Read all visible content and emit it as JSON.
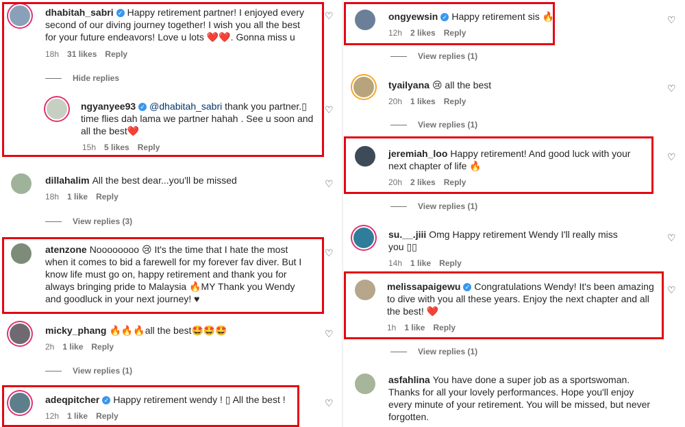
{
  "left": {
    "c1": {
      "user": "dhabitah_sabri",
      "text": "Happy retirement partner! I enjoyed every second of our diving journey together! I wish you all the best for your future endeavors! Love u lots ❤️❤️. Gonna miss u",
      "time": "18h",
      "likes": "31 likes",
      "reply": "Reply"
    },
    "hide": "Hide replies",
    "c1r": {
      "user": "ngyanyee93",
      "mention": "@dhabitah_sabri",
      "text": "thank you partner.▯ time flies dah lama we partner hahah . See u soon and all the best❤️",
      "time": "15h",
      "likes": "5 likes",
      "reply": "Reply"
    },
    "c2": {
      "user": "dillahalim",
      "text": "All the best dear...you'll be missed",
      "time": "18h",
      "likes": "1 like",
      "reply": "Reply",
      "view": "View replies (3)"
    },
    "c3": {
      "user": "atenzone",
      "text": "Noooooooo 😢 It's the time that I hate the most when it comes to bid a farewell for my forever fav diver. But I know life must go on, happy retirement and thank you for always bringing pride to Malaysia 🔥MY Thank you Wendy and goodluck in your next journey! ♥"
    },
    "c4": {
      "user": "micky_phang",
      "text": "🔥🔥🔥all the best🤩🤩🤩",
      "time": "2h",
      "likes": "1 like",
      "reply": "Reply",
      "view": "View replies (1)"
    },
    "c5": {
      "user": "adeqpitcher",
      "text": "Happy retirement wendy ! ▯ All the best !",
      "time": "12h",
      "likes": "1 like",
      "reply": "Reply"
    }
  },
  "right": {
    "c1": {
      "user": "ongyewsin",
      "text": "Happy retirement sis 🔥",
      "time": "12h",
      "likes": "2 likes",
      "reply": "Reply",
      "view": "View replies (1)"
    },
    "c2": {
      "user": "tyailyana",
      "text": "😢 all the best",
      "time": "20h",
      "likes": "1 likes",
      "reply": "Reply",
      "view": "View replies (1)"
    },
    "c3": {
      "user": "jeremiah_loo",
      "text": "Happy retirement! And good luck with your next chapter of life 🔥",
      "time": "20h",
      "likes": "2 likes",
      "reply": "Reply",
      "view": "View replies (1)"
    },
    "c4": {
      "user": "su.__.jiii",
      "text": "Omg Happy retirement Wendy I'll really miss you ▯▯",
      "time": "14h",
      "likes": "1 like",
      "reply": "Reply"
    },
    "c5": {
      "user": "melissapaigewu",
      "text": "Congratulations Wendy! It's been amazing to dive with you all these years. Enjoy the next chapter and all the best! ❤️",
      "time": "1h",
      "likes": "1 like",
      "reply": "Reply",
      "view": "View replies (1)"
    },
    "c6": {
      "user": "asfahlina",
      "text": "You have done a super job as a sportswoman. Thanks for all your lovely performances. Hope you'll enjoy every minute of your retirement. You will be missed, but never forgotten."
    }
  },
  "icons": {
    "heart": "heart-icon",
    "verified": "verified-badge-icon"
  },
  "colors": {
    "highlight": "#e30613",
    "verified": "#3897f0",
    "meta": "#737373"
  }
}
